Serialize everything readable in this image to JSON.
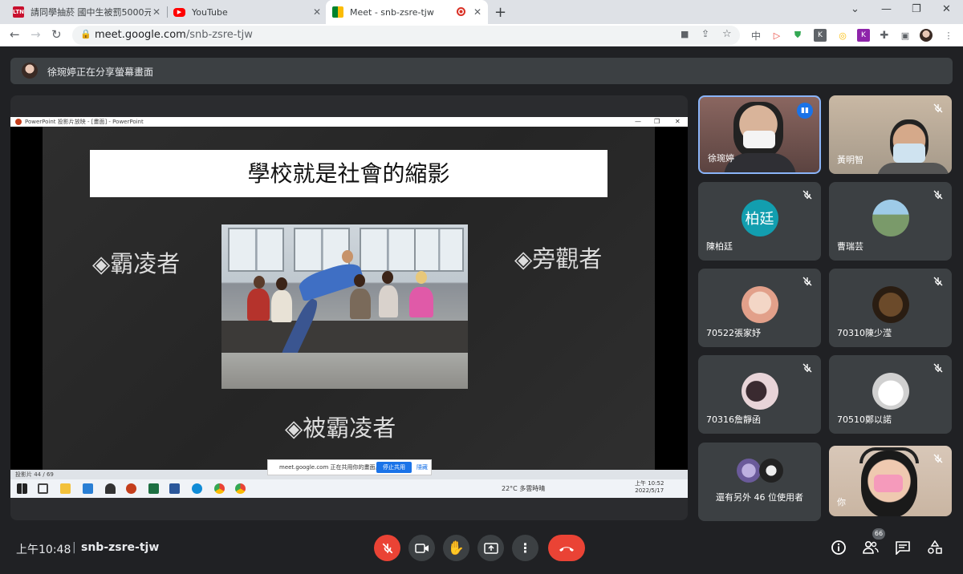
{
  "browser": {
    "tabs": [
      {
        "title": "請同學抽菸 國中生被罰5000元 -",
        "favicon": "LTN"
      },
      {
        "title": "YouTube"
      },
      {
        "title": "Meet - snb-zsre-tjw"
      }
    ],
    "url_host": "meet.google.com",
    "url_path": "/snb-zsre-tjw",
    "ext_cn": "中"
  },
  "presenting_banner": "徐琬婷正在分享螢幕畫面",
  "shared_screen": {
    "window_title": "PowerPoint 投影片放映 - [畫面] - PowerPoint",
    "slide_title": "學校就是社會的縮影",
    "roles": [
      "◈霸凌者",
      "◈旁觀者",
      "◈被霸凌者"
    ],
    "slide_counter": "投影片 44 / 69",
    "share_notice": "meet.google.com 正在共用你的畫面。",
    "stop_share": "停止共用",
    "hide": "隱藏",
    "weather": "22°C 多雲時晴",
    "clock_time": "上午 10:52",
    "clock_date": "2022/5/17"
  },
  "participants": [
    {
      "name": "徐琬婷",
      "speaking": true
    },
    {
      "name": "黃明智"
    },
    {
      "name": "陳柏廷",
      "avatar_text": "柏廷",
      "avatar_color": "#129eaf"
    },
    {
      "name": "曹瑞芸"
    },
    {
      "name": "70522張家妤"
    },
    {
      "name": "70310陳少滢"
    },
    {
      "name": "70316詹靜函"
    },
    {
      "name": "70510鄭以諾"
    },
    {
      "name": "還有另外 46 位使用者"
    },
    {
      "name": "你"
    }
  ],
  "call": {
    "time": "上午10:48",
    "separator": "|",
    "meeting_code": "snb-zsre-tjw",
    "people_count": "66"
  },
  "colors": {
    "accent": "#8ab4f8",
    "danger": "#ea4335",
    "bg": "#202124"
  }
}
